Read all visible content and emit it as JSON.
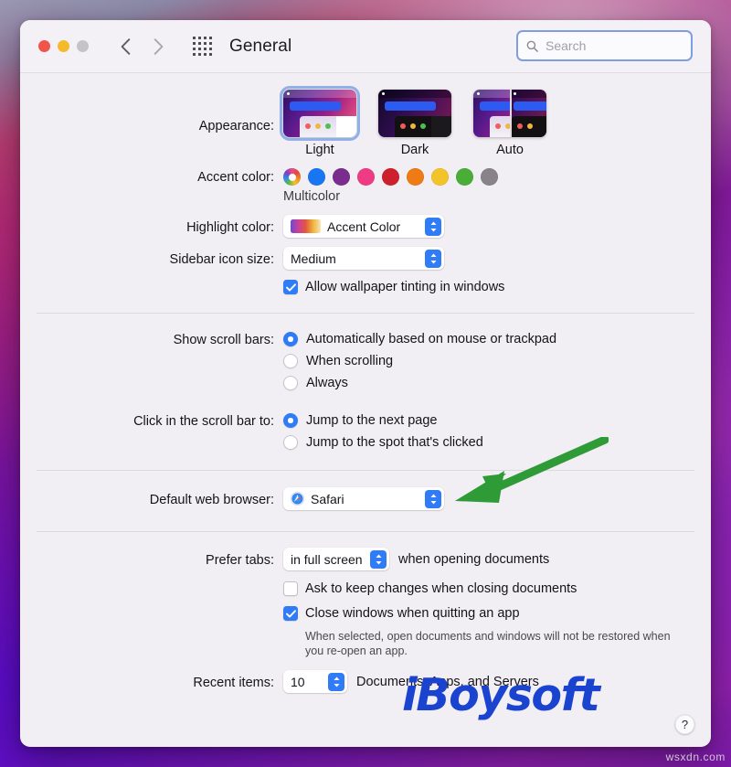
{
  "window": {
    "title": "General",
    "traffic_lights": [
      "close",
      "minimize",
      "zoom"
    ],
    "back_label": "Back",
    "forward_label": "Forward",
    "grid_label": "Show All"
  },
  "search": {
    "placeholder": "Search",
    "value": "",
    "icon": "search-icon"
  },
  "appearance": {
    "label": "Appearance:",
    "options": [
      {
        "label": "Light",
        "selected": true
      },
      {
        "label": "Dark",
        "selected": false
      },
      {
        "label": "Auto",
        "selected": false
      }
    ]
  },
  "accent": {
    "label": "Accent color:",
    "caption": "Multicolor",
    "selected": "multicolor",
    "swatches": [
      {
        "name": "multicolor",
        "color": "#ffffff"
      },
      {
        "name": "blue",
        "color": "#1876f2"
      },
      {
        "name": "purple",
        "color": "#7b2d8e"
      },
      {
        "name": "pink",
        "color": "#ef3a84"
      },
      {
        "name": "red",
        "color": "#cd1f2d"
      },
      {
        "name": "orange",
        "color": "#ef7b14"
      },
      {
        "name": "yellow",
        "color": "#f3c32a"
      },
      {
        "name": "green",
        "color": "#4aad38"
      },
      {
        "name": "graphite",
        "color": "#888289"
      }
    ]
  },
  "highlight": {
    "label": "Highlight color:",
    "value": "Accent Color"
  },
  "sidebar_icon_size": {
    "label": "Sidebar icon size:",
    "value": "Medium"
  },
  "wallpaper_tinting": {
    "label": "Allow wallpaper tinting in windows",
    "checked": true
  },
  "scroll_bars": {
    "label": "Show scroll bars:",
    "options": [
      {
        "label": "Automatically based on mouse or trackpad",
        "selected": true
      },
      {
        "label": "When scrolling",
        "selected": false
      },
      {
        "label": "Always",
        "selected": false
      }
    ]
  },
  "click_scroll_bar": {
    "label": "Click in the scroll bar to:",
    "options": [
      {
        "label": "Jump to the next page",
        "selected": true
      },
      {
        "label": "Jump to the spot that's clicked",
        "selected": false
      }
    ]
  },
  "default_browser": {
    "label": "Default web browser:",
    "value": "Safari",
    "icon": "safari-icon"
  },
  "prefer_tabs": {
    "label": "Prefer tabs:",
    "value": "in full screen",
    "suffix": "when opening documents"
  },
  "ask_keep_changes": {
    "label": "Ask to keep changes when closing documents",
    "checked": false
  },
  "close_windows": {
    "label": "Close windows when quitting an app",
    "checked": true
  },
  "close_windows_hint": "When selected, open documents and windows will not be restored when you re-open an app.",
  "recent_items": {
    "label": "Recent items:",
    "value": "10",
    "suffix": "Documents, Apps, and Servers"
  },
  "help": {
    "label": "?"
  },
  "annotation": {
    "arrow_color": "#2e9b36"
  },
  "watermarks": {
    "brand": "iBoysoft",
    "site": "wsxdn.com"
  }
}
